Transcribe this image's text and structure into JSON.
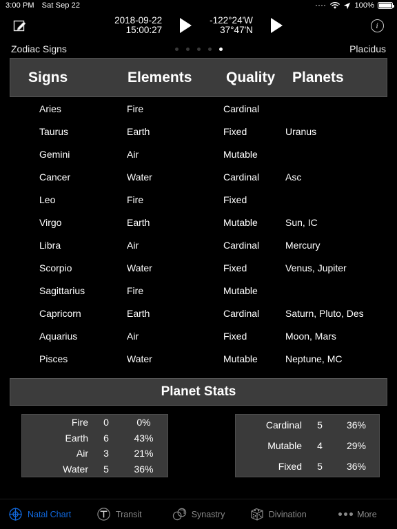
{
  "status_bar": {
    "time": "3:00 PM",
    "date": "Sat Sep 22",
    "battery_percent": "100%",
    "icons": [
      "signal-dots-icon",
      "wifi-icon",
      "location-arrow-icon",
      "battery-icon"
    ]
  },
  "toolbar": {
    "compose_icon": "compose-edit-icon",
    "date": "2018-09-22",
    "time": "15:00:27",
    "longitude": "-122°24'W",
    "latitude": "37°47'N",
    "play_time_icon": "play-triangle-icon",
    "play_location_icon": "play-triangle-icon",
    "info_icon": "info-circle-icon",
    "info_label": "i"
  },
  "subheader": {
    "left_title": "Zodiac Signs",
    "right_title": "Placidus",
    "page_dots": 5,
    "active_dot": 5
  },
  "table": {
    "headers": [
      "Signs",
      "Elements",
      "Quality",
      "Planets"
    ],
    "rows": [
      {
        "sign": "Aries",
        "element": "Fire",
        "quality": "Cardinal",
        "planets": ""
      },
      {
        "sign": "Taurus",
        "element": "Earth",
        "quality": "Fixed",
        "planets": "Uranus"
      },
      {
        "sign": "Gemini",
        "element": "Air",
        "quality": "Mutable",
        "planets": ""
      },
      {
        "sign": "Cancer",
        "element": "Water",
        "quality": "Cardinal",
        "planets": "Asc"
      },
      {
        "sign": "Leo",
        "element": "Fire",
        "quality": "Fixed",
        "planets": ""
      },
      {
        "sign": "Virgo",
        "element": "Earth",
        "quality": "Mutable",
        "planets": "Sun, IC"
      },
      {
        "sign": "Libra",
        "element": "Air",
        "quality": "Cardinal",
        "planets": "Mercury"
      },
      {
        "sign": "Scorpio",
        "element": "Water",
        "quality": "Fixed",
        "planets": "Venus, Jupiter"
      },
      {
        "sign": "Sagittarius",
        "element": "Fire",
        "quality": "Mutable",
        "planets": ""
      },
      {
        "sign": "Capricorn",
        "element": "Earth",
        "quality": "Cardinal",
        "planets": "Saturn, Pluto, Des"
      },
      {
        "sign": "Aquarius",
        "element": "Air",
        "quality": "Fixed",
        "planets": "Moon, Mars"
      },
      {
        "sign": "Pisces",
        "element": "Water",
        "quality": "Mutable",
        "planets": "Neptune, MC"
      }
    ]
  },
  "planet_stats": {
    "title": "Planet Stats",
    "elements": [
      {
        "name": "Fire",
        "count": "0",
        "percent": "0%"
      },
      {
        "name": "Earth",
        "count": "6",
        "percent": "43%"
      },
      {
        "name": "Air",
        "count": "3",
        "percent": "21%"
      },
      {
        "name": "Water",
        "count": "5",
        "percent": "36%"
      }
    ],
    "qualities": [
      {
        "name": "Cardinal",
        "count": "5",
        "percent": "36%"
      },
      {
        "name": "Mutable",
        "count": "4",
        "percent": "29%"
      },
      {
        "name": "Fixed",
        "count": "5",
        "percent": "36%"
      }
    ]
  },
  "tabbar": {
    "active_color": "#1168dd",
    "inactive_color": "#8a8a8a",
    "tabs": [
      {
        "label": "Natal Chart",
        "icon": "natal-chart-crosshair-icon",
        "active": true
      },
      {
        "label": "Transit",
        "icon": "transit-t-circle-icon",
        "active": false
      },
      {
        "label": "Synastry",
        "icon": "synastry-two-circles-icon",
        "active": false
      },
      {
        "label": "Divination",
        "icon": "divination-dice-icon",
        "active": false
      },
      {
        "label": "More",
        "icon": "more-dots-icon",
        "active": false
      }
    ]
  }
}
